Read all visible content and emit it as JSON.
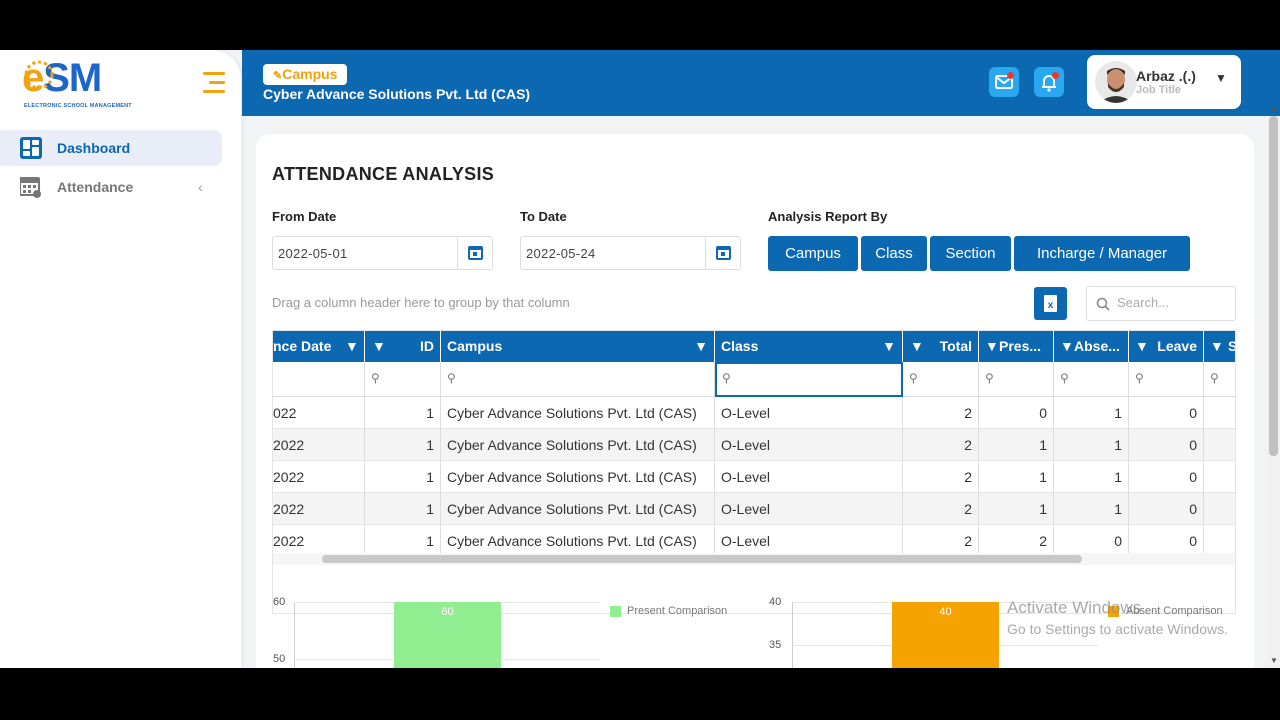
{
  "logo": {
    "brand_e": "e",
    "brand_rest": "SM",
    "tagline": "ELECTRONIC SCHOOL MANAGEMENT"
  },
  "sidebar": {
    "items": [
      {
        "label": "Dashboard",
        "icon": "dashboard-grid-icon"
      },
      {
        "label": "Attendance",
        "icon": "calendar-icon"
      }
    ]
  },
  "header": {
    "badge": "Campus",
    "org_name": "Cyber Advance Solutions Pvt. Ltd (CAS)",
    "user_name": "Arbaz .(.)",
    "user_title": "Job Title"
  },
  "page": {
    "title": "ATTENDANCE ANALYSIS",
    "from_label": "From Date",
    "from_value": "2022-05-01",
    "to_label": "To Date",
    "to_value": "2022-05-24",
    "report_label": "Analysis Report By",
    "report_buttons": [
      "Campus",
      "Class",
      "Section",
      "Incharge / Manager"
    ],
    "drag_hint": "Drag a column header here to group by that column",
    "search_placeholder": "Search..."
  },
  "grid": {
    "columns": [
      "nce Date",
      "ID",
      "Campus",
      "Class",
      "Total",
      "Pres...",
      "Abse...",
      "Leave",
      "S"
    ],
    "rows": [
      [
        "022",
        "1",
        "Cyber Advance Solutions Pvt. Ltd (CAS)",
        "O-Level",
        "2",
        "0",
        "1",
        "0"
      ],
      [
        "2022",
        "1",
        "Cyber Advance Solutions Pvt. Ltd (CAS)",
        "O-Level",
        "2",
        "1",
        "1",
        "0"
      ],
      [
        "2022",
        "1",
        "Cyber Advance Solutions Pvt. Ltd (CAS)",
        "O-Level",
        "2",
        "1",
        "1",
        "0"
      ],
      [
        "2022",
        "1",
        "Cyber Advance Solutions Pvt. Ltd (CAS)",
        "O-Level",
        "2",
        "1",
        "1",
        "0"
      ],
      [
        "2022",
        "1",
        "Cyber Advance Solutions Pvt. Ltd (CAS)",
        "O-Level",
        "2",
        "2",
        "0",
        "0"
      ]
    ]
  },
  "chart_data": [
    {
      "type": "bar",
      "series": [
        {
          "name": "Present Comparison",
          "values": [
            60
          ],
          "color": "#90ee90"
        }
      ],
      "y_ticks": [
        "60",
        "50"
      ],
      "data_labels": [
        "60"
      ]
    },
    {
      "type": "bar",
      "series": [
        {
          "name": "Absent Comparison",
          "values": [
            40
          ],
          "color": "#f5a300"
        }
      ],
      "y_ticks": [
        "40",
        "35"
      ],
      "data_labels": [
        "40"
      ]
    }
  ],
  "watermark": {
    "line1": "Activate Windows",
    "line2": "Go to Settings to activate Windows."
  },
  "colors": {
    "primary": "#0c69b1",
    "accent": "#f2a20e",
    "present": "#90ee90",
    "absent": "#f5a300"
  }
}
